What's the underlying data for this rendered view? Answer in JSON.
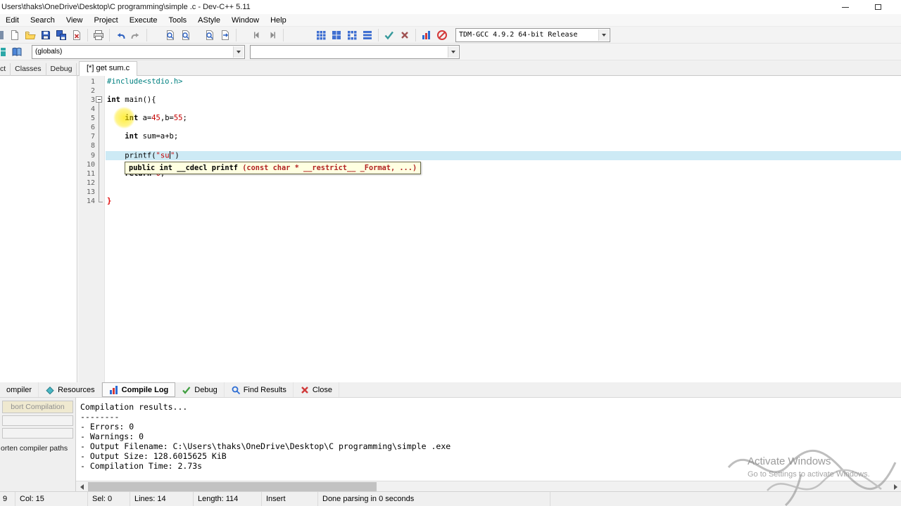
{
  "window": {
    "title": "Users\\thaks\\OneDrive\\Desktop\\C programming\\simple .c - Dev-C++ 5.11"
  },
  "menu": [
    "Edit",
    "Search",
    "View",
    "Project",
    "Execute",
    "Tools",
    "AStyle",
    "Window",
    "Help"
  ],
  "toolbar": {
    "compiler_profile": "TDM-GCC 4.9.2 64-bit Release"
  },
  "classbrowser": {
    "scope_select": "(globals)",
    "member_select": ""
  },
  "panel_tabs": [
    "ct",
    "Classes",
    "Debug"
  ],
  "editor": {
    "tab": "[*] get sum.c",
    "lines": [
      {
        "n": "1",
        "segs": [
          {
            "t": "#include<stdio.h>",
            "c": "pp"
          }
        ]
      },
      {
        "n": "2",
        "segs": []
      },
      {
        "n": "3",
        "segs": [
          {
            "t": "int",
            "c": "kw"
          },
          {
            "t": " main(){",
            "c": "pl"
          }
        ]
      },
      {
        "n": "4",
        "segs": []
      },
      {
        "n": "5",
        "segs": [
          {
            "t": "    ",
            "c": "pl"
          },
          {
            "t": "int",
            "c": "kw"
          },
          {
            "t": " a=",
            "c": "pl"
          },
          {
            "t": "45",
            "c": "num"
          },
          {
            "t": ",b=",
            "c": "pl"
          },
          {
            "t": "55",
            "c": "num"
          },
          {
            "t": ";",
            "c": "pl"
          }
        ]
      },
      {
        "n": "6",
        "segs": []
      },
      {
        "n": "7",
        "segs": [
          {
            "t": "    ",
            "c": "pl"
          },
          {
            "t": "int",
            "c": "kw"
          },
          {
            "t": " sum=a+b;",
            "c": "pl"
          }
        ]
      },
      {
        "n": "8",
        "segs": []
      },
      {
        "n": "9",
        "current": true,
        "caret_after": 2,
        "segs": [
          {
            "t": "    printf(",
            "c": "pl"
          },
          {
            "t": "\"su",
            "c": "str"
          },
          {
            "t": "\"",
            "c": "str"
          },
          {
            "t": ")",
            "c": "pl"
          }
        ]
      },
      {
        "n": "10",
        "segs": []
      },
      {
        "n": "11",
        "segs": [
          {
            "t": "    ",
            "c": "pl"
          },
          {
            "t": "return",
            "c": "kw"
          },
          {
            "t": " ",
            "c": "pl"
          },
          {
            "t": "0",
            "c": "num"
          },
          {
            "t": ";",
            "c": "pl"
          }
        ]
      },
      {
        "n": "12",
        "segs": []
      },
      {
        "n": "13",
        "segs": []
      },
      {
        "n": "14",
        "segs": [
          {
            "t": "}",
            "c": "brace"
          }
        ]
      }
    ],
    "tooltip": [
      {
        "t": "public int __cdecl printf ",
        "c": "b"
      },
      {
        "t": "(const char * __restrict__ _Format, ...)",
        "c": "r"
      }
    ]
  },
  "bottom_tabs": [
    {
      "label": "ompiler",
      "icon": "none",
      "active": false
    },
    {
      "label": "Resources",
      "icon": "resources",
      "active": false
    },
    {
      "label": "Compile Log",
      "icon": "chart",
      "active": true
    },
    {
      "label": "Debug",
      "icon": "check",
      "active": false
    },
    {
      "label": "Find Results",
      "icon": "magnifier",
      "active": false
    },
    {
      "label": "Close",
      "icon": "close",
      "active": false
    }
  ],
  "compiler_panel": {
    "abort_button": "bort Compilation",
    "shorten_paths": "orten compiler paths"
  },
  "compile_log": [
    "Compilation results...",
    "--------",
    "- Errors: 0",
    "- Warnings: 0",
    "- Output Filename: C:\\Users\\thaks\\OneDrive\\Desktop\\C programming\\simple .exe",
    "- Output Size: 128.6015625 KiB",
    "- Compilation Time: 2.73s"
  ],
  "status_bar": [
    "9",
    "Col: 15",
    "Sel: 0",
    "Lines: 14",
    "Length: 114",
    "Insert",
    "Done parsing in 0 seconds",
    ""
  ],
  "watermark": {
    "line1": "Activate Windows",
    "line2": "Go to Settings to activate Windows."
  },
  "colors": {
    "current_line": "#cdeaf5",
    "preprocessor": "#008080",
    "number": "#c40000",
    "string": "#c40000",
    "brace_match": "#e00000",
    "tooltip_bg": "#ffffe1",
    "tooltip_param": "#b22222",
    "mouse_highlight": "#ffe800"
  }
}
